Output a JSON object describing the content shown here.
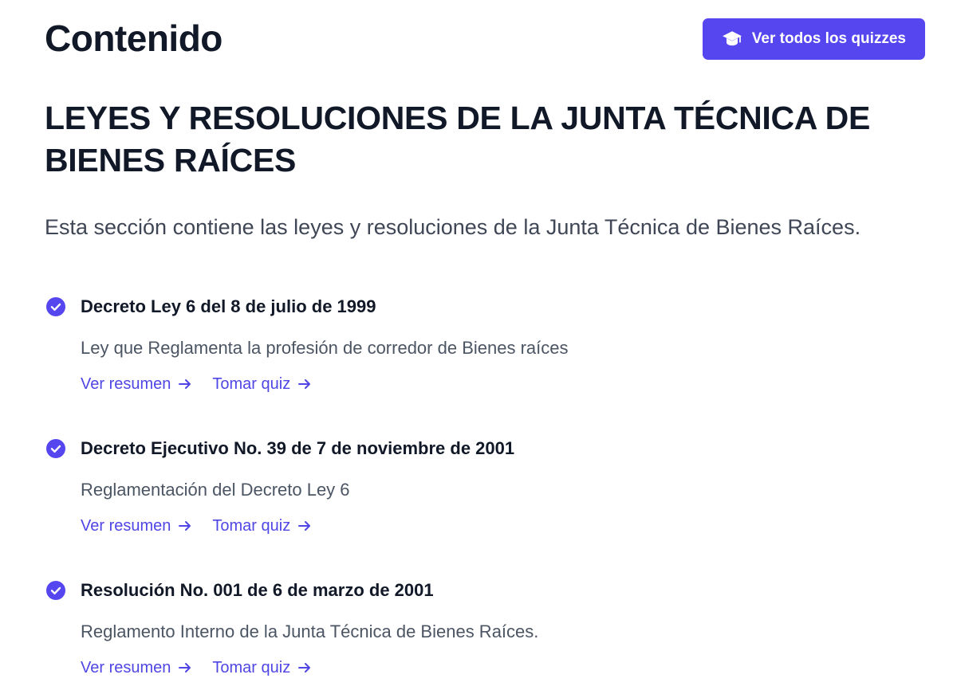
{
  "header": {
    "title": "Contenido",
    "quiz_button_label": "Ver todos los quizzes",
    "quiz_button_icon": "graduation-cap-icon"
  },
  "section": {
    "heading": "LEYES Y RESOLUCIONES DE LA JUNTA TÉCNICA DE BIENES RAÍCES",
    "intro": "Esta sección contiene las leyes y resoluciones de la Junta Técnica de Bienes Raíces."
  },
  "items": [
    {
      "title": "Decreto Ley 6 del 8 de julio de 1999",
      "description": "Ley que Reglamenta la profesión de corredor de Bienes raíces",
      "summary_link": "Ver resumen",
      "quiz_link": "Tomar quiz",
      "completed": true
    },
    {
      "title": "Decreto Ejecutivo No. 39 de 7 de noviembre de 2001",
      "description": "Reglamentación del Decreto Ley 6",
      "summary_link": "Ver resumen",
      "quiz_link": "Tomar quiz",
      "completed": true
    },
    {
      "title": "Resolución No. 001 de 6 de marzo de 2001",
      "description": "Reglamento Interno de la Junta Técnica de Bienes Raíces.",
      "summary_link": "Ver resumen",
      "quiz_link": "Tomar quiz",
      "completed": true
    }
  ],
  "colors": {
    "accent": "#5546f0",
    "link": "#4f46e5",
    "heading": "#111827",
    "body_text": "#4b5563"
  }
}
